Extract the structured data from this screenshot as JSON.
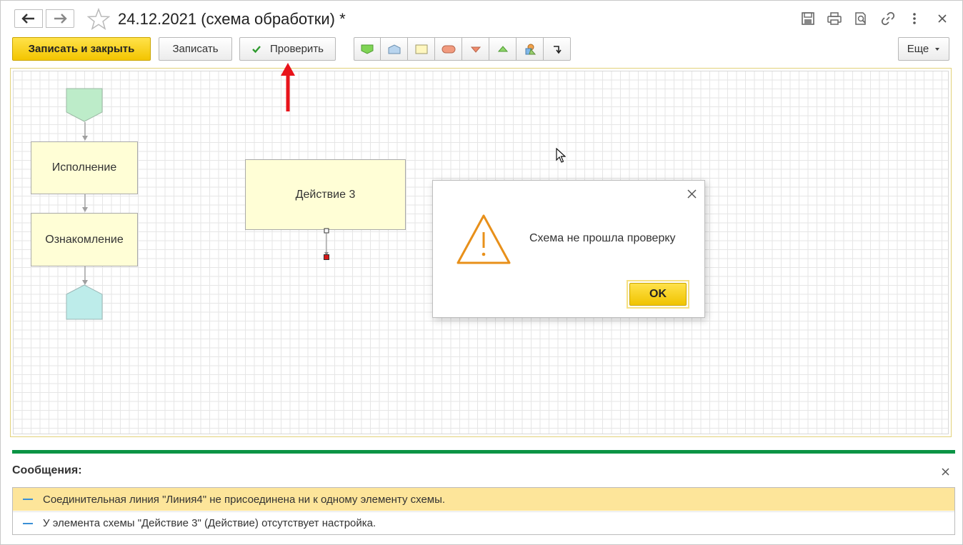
{
  "window": {
    "title": "24.12.2021 (схема обработки) *"
  },
  "toolbar": {
    "save_close_label": "Записать и закрыть",
    "save_label": "Записать",
    "check_label": "Проверить",
    "more_label": "Еще",
    "shape_tools": [
      "start-point-icon",
      "end-point-icon",
      "action-icon",
      "activity-icon",
      "split-icon",
      "merge-icon",
      "condition-icon",
      "connector-line-icon"
    ]
  },
  "schema": {
    "box_execution": "Исполнение",
    "box_acquaintance": "Ознакомление",
    "box_action3": "Действие 3"
  },
  "dialog": {
    "message": "Схема не прошла проверку",
    "ok_label": "OK"
  },
  "messages": {
    "title": "Сообщения:",
    "items": [
      "Соединительная линия \"Линия4\" не присоединена ни к одному элементу схемы.",
      "У элемента схемы \"Действие 3\" (Действие) отсутствует настройка."
    ]
  },
  "colors": {
    "accent_yellow": "#f3c500",
    "message_highlight": "#fde59a",
    "green_bar": "#0b9445",
    "warning_orange": "#e8901a",
    "annotation_red": "#e8131a"
  }
}
